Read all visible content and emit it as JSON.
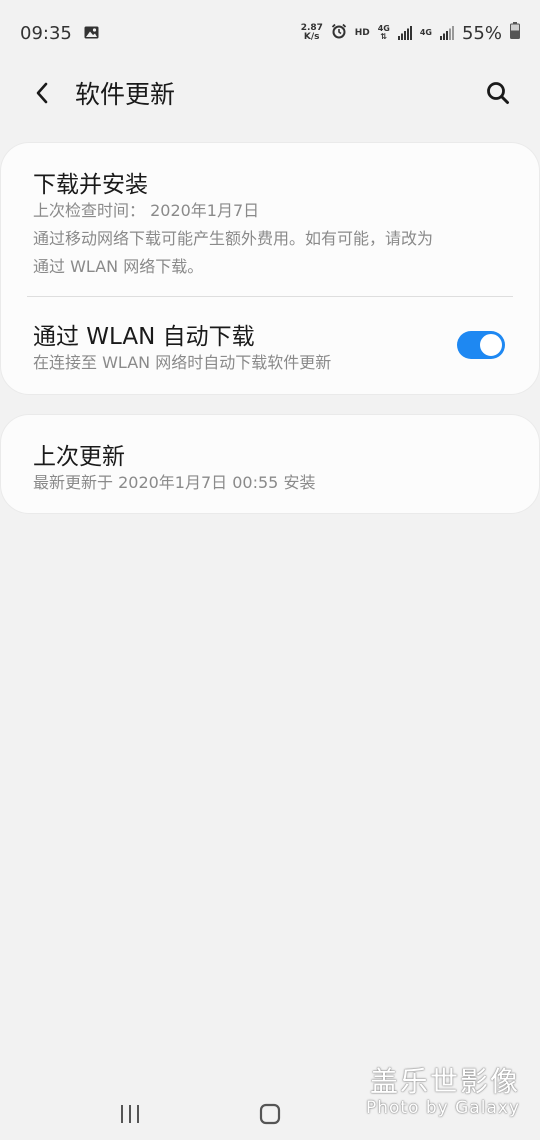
{
  "status_bar": {
    "time": "09:35",
    "speed_value": "2.87",
    "speed_unit": "K/s",
    "hd": "HD",
    "net_1": "4G",
    "net_2": "4G",
    "battery": "55%",
    "icons": [
      "image-icon",
      "alarm-icon",
      "signal-icon",
      "battery-icon"
    ]
  },
  "header": {
    "title": "软件更新",
    "back_icon": "chevron-left-icon",
    "search_icon": "search-icon"
  },
  "download_card": {
    "title": "下载并安装",
    "last_check": "上次检查时间： 2020年1月7日",
    "note_line1": "通过移动网络下载可能产生额外费用。如有可能，请改为",
    "note_line2": "通过 WLAN 网络下载。"
  },
  "auto_download": {
    "title": "通过 WLAN 自动下载",
    "subtitle": "在连接至 WLAN 网络时自动下载软件更新",
    "enabled": true
  },
  "last_update_card": {
    "title": "上次更新",
    "subtitle": "最新更新于 2020年1月7日 00:55 安装"
  },
  "watermark": {
    "cn": "盖乐世影像",
    "en": "Photo by Galaxy"
  },
  "nav_bar": {
    "recent_icon": "recent-apps-icon",
    "home_icon": "home-icon"
  },
  "colors": {
    "accent": "#1e88f2",
    "background": "#f2f2f2",
    "card": "#fcfcfc",
    "secondary_text": "#8a8a8a"
  }
}
